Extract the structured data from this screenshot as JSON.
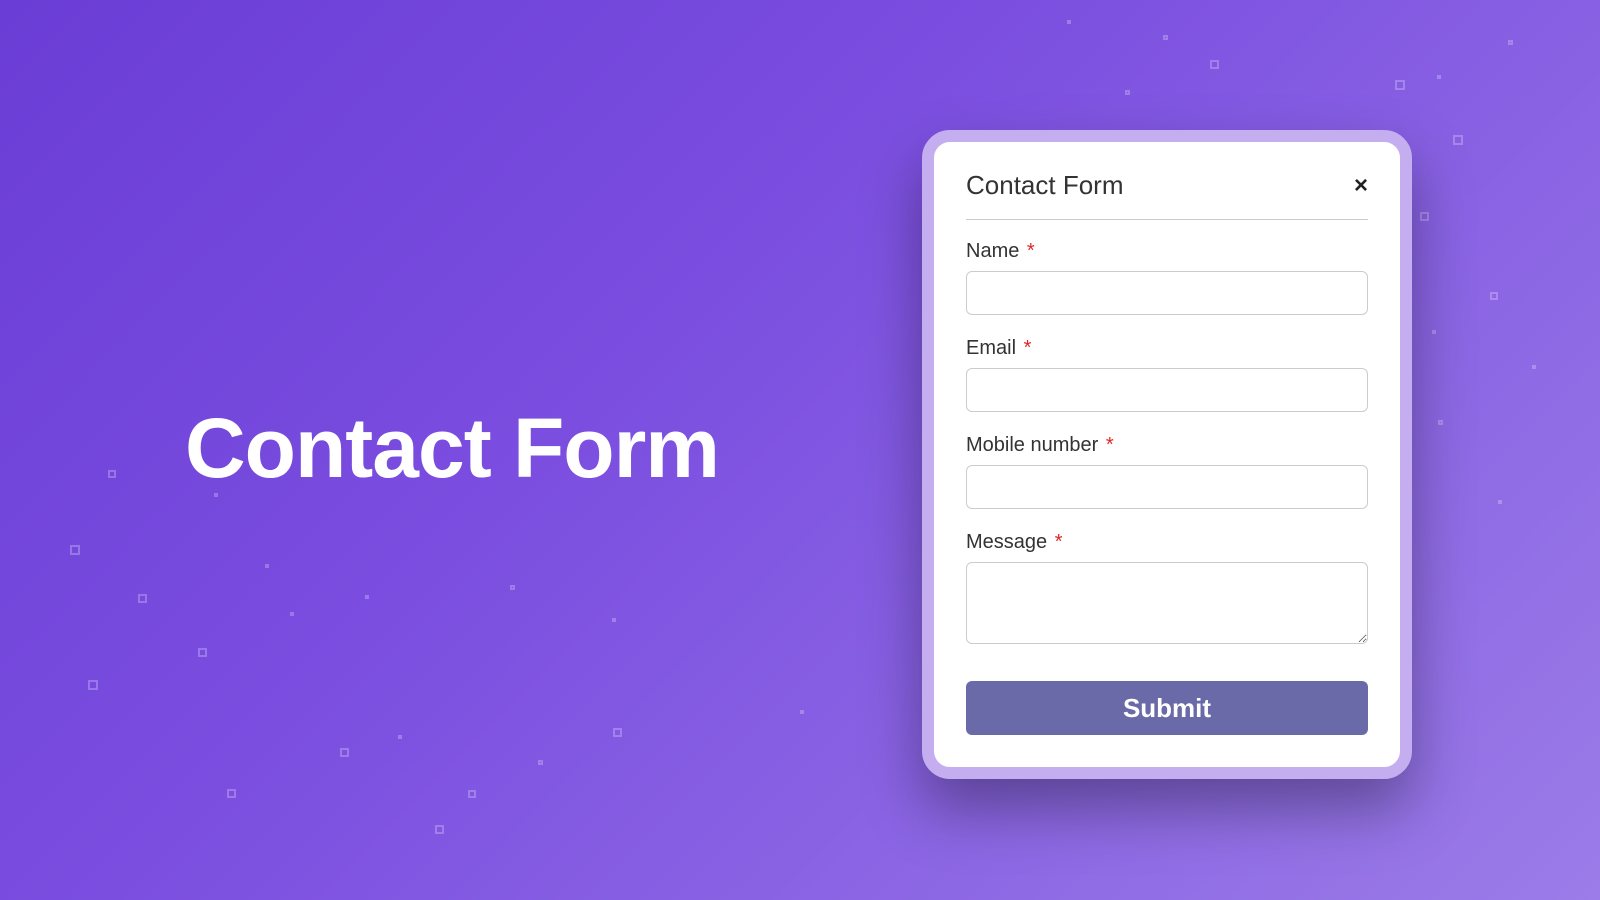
{
  "hero": {
    "title": "Contact Form"
  },
  "card": {
    "title": "Contact Form",
    "close_glyph": "×",
    "fields": {
      "name": {
        "label": "Name",
        "required": "*"
      },
      "email": {
        "label": "Email",
        "required": "*"
      },
      "mobile": {
        "label": "Mobile number",
        "required": "*"
      },
      "message": {
        "label": "Message",
        "required": "*"
      }
    },
    "submit_label": "Submit"
  },
  "colors": {
    "accent": "#6b6aa8",
    "required": "#e02424",
    "card_border": "#c4aeef"
  }
}
